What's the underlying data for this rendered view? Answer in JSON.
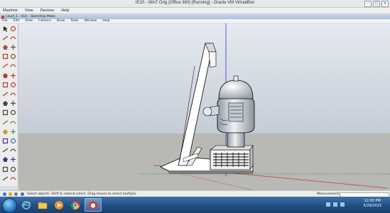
{
  "vm_window": {
    "title": "IE10 - Win7 Orig (Office 360) [Running] - Oracle VM VirtualBox",
    "menu": [
      "Machine",
      "View",
      "Devices",
      "Help"
    ]
  },
  "sketchup": {
    "title": "Lloyd_1 - SU1 - SketchUp Make",
    "menu": [
      "File",
      "Edit",
      "View",
      "Camera",
      "Draw",
      "Tools",
      "Window",
      "Help"
    ]
  },
  "toolbar_icons": [
    "select-icon",
    "eraser-icon",
    "line-icon",
    "freehand-icon",
    "rectangle-icon",
    "rotated-rectangle-icon",
    "circle-icon",
    "polygon-icon",
    "arc-icon",
    "pie-icon",
    "push-pull-icon",
    "follow-me-icon",
    "move-icon",
    "rotate-icon",
    "scale-icon",
    "offset-icon",
    "tape-measure-icon",
    "protractor-icon",
    "dimension-icon",
    "text-icon",
    "axes-icon",
    "3d-text-icon",
    "paint-bucket-icon",
    "section-plane-icon",
    "orbit-icon",
    "pan-icon",
    "zoom-icon",
    "zoom-extents-icon",
    "previous-view-icon",
    "next-view-icon",
    "position-camera-icon",
    "walk-icon",
    "look-around-icon",
    "warehouse-icon"
  ],
  "status": {
    "hint": "Select objects. Shift to extend select. Drag mouse to select multiple.",
    "measurements_label": "Measurements",
    "measurements_value": ""
  },
  "taskbar": {
    "apps": [
      "ie-icon",
      "explorer-icon",
      "media-player-icon",
      "chrome-icon",
      "sketchup-icon"
    ],
    "clock_time": "12:00 PM",
    "clock_date": "5/29/2015"
  },
  "colors": {
    "sky": "#ccd3dd",
    "ground": "#b9b9b6",
    "taskbar": "#1f4c82",
    "red_axis": "#c0392b",
    "green_axis": "#3a8a3a",
    "blue_axis": "#2b3fd6"
  }
}
